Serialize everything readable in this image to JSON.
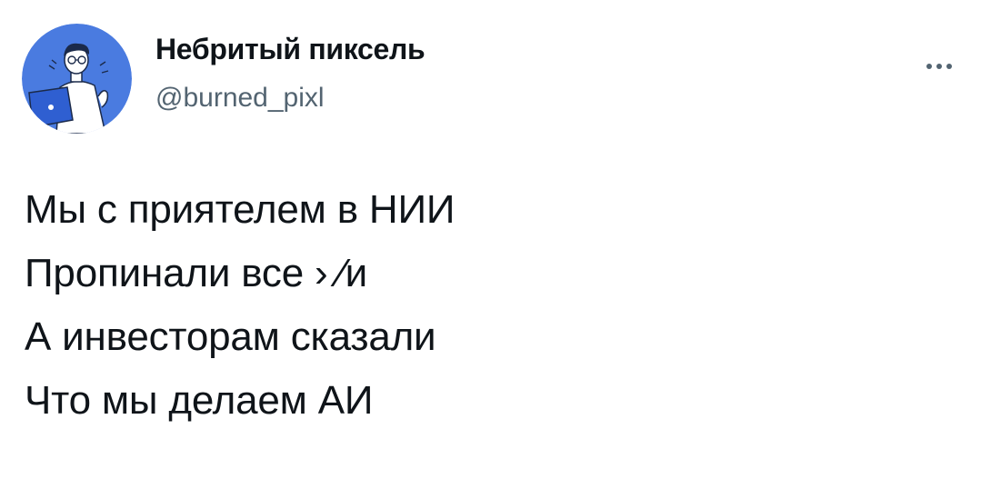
{
  "author": {
    "display_name": "Небритый пиксель",
    "handle": "@burned_pixl",
    "avatar_icon": "avatar-illustration-person-laptop"
  },
  "actions": {
    "more_icon": "more-horizontal-icon"
  },
  "tweet": {
    "lines": [
      "Мы с приятелем в НИИ",
      "Пропинали все › ⁄и",
      "А инвесторам сказали",
      "Что мы делаем АИ"
    ]
  },
  "colors": {
    "primary_text": "#0f1419",
    "secondary_text": "#536471",
    "avatar_bg": "#4a7be0",
    "background": "#ffffff"
  }
}
